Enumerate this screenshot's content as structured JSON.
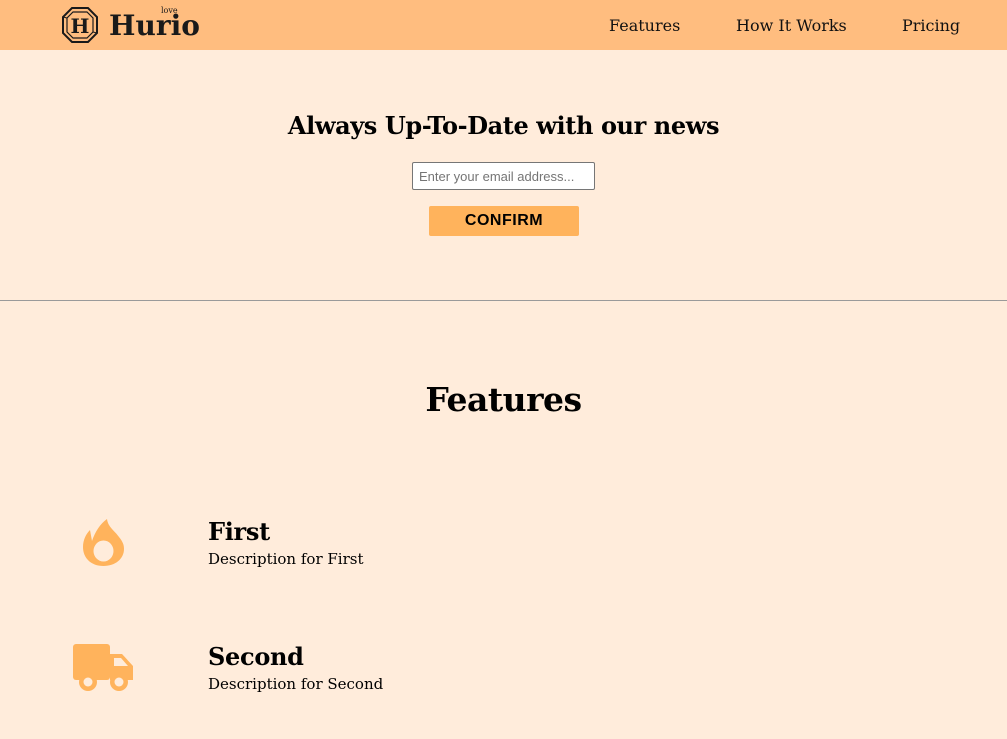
{
  "navbar": {
    "logo": {
      "icon": "hexagon-h-logo-icon",
      "text": "Hurio",
      "tagline": "love"
    },
    "links": [
      {
        "label": "Features"
      },
      {
        "label": "How It Works"
      },
      {
        "label": "Pricing"
      }
    ],
    "background_color": "#ffbd7f"
  },
  "newsletter": {
    "title": "Always Up-To-Date with our news",
    "email_placeholder": "Enter your email address...",
    "email_value": "",
    "confirm_label": "CONFIRM",
    "button_color": "#ffb35c"
  },
  "features": {
    "title": "Features",
    "items": [
      {
        "icon": "fire-icon",
        "title": "First",
        "description": "Description for First"
      },
      {
        "icon": "truck-icon",
        "title": "Second",
        "description": "Description for Second"
      }
    ],
    "icon_color": "#ffb35c"
  },
  "page_background": "#ffecdb"
}
